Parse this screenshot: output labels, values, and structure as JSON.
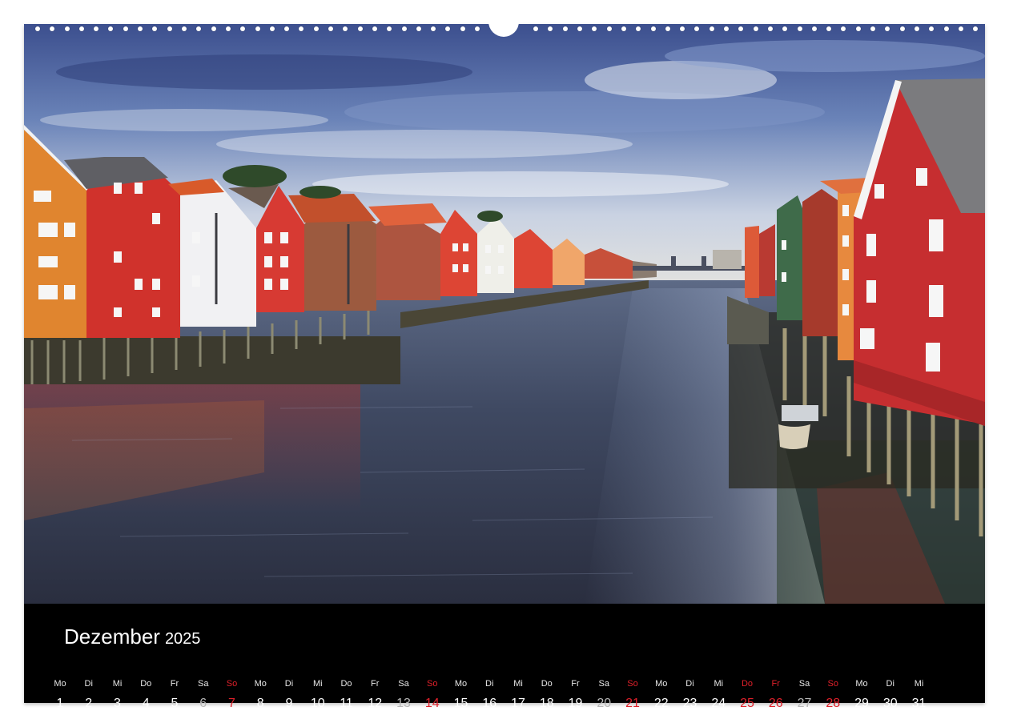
{
  "calendar": {
    "month": "Dezember",
    "year": "2025",
    "days": [
      {
        "dow": "Mo",
        "num": "1",
        "type": "normal"
      },
      {
        "dow": "Di",
        "num": "2",
        "type": "normal"
      },
      {
        "dow": "Mi",
        "num": "3",
        "type": "normal"
      },
      {
        "dow": "Do",
        "num": "4",
        "type": "normal"
      },
      {
        "dow": "Fr",
        "num": "5",
        "type": "normal"
      },
      {
        "dow": "Sa",
        "num": "6",
        "type": "saturday"
      },
      {
        "dow": "So",
        "num": "7",
        "type": "holiday"
      },
      {
        "dow": "Mo",
        "num": "8",
        "type": "normal"
      },
      {
        "dow": "Di",
        "num": "9",
        "type": "normal"
      },
      {
        "dow": "Mi",
        "num": "10",
        "type": "normal"
      },
      {
        "dow": "Do",
        "num": "11",
        "type": "normal"
      },
      {
        "dow": "Fr",
        "num": "12",
        "type": "normal"
      },
      {
        "dow": "Sa",
        "num": "13",
        "type": "saturday"
      },
      {
        "dow": "So",
        "num": "14",
        "type": "holiday"
      },
      {
        "dow": "Mo",
        "num": "15",
        "type": "normal"
      },
      {
        "dow": "Di",
        "num": "16",
        "type": "normal"
      },
      {
        "dow": "Mi",
        "num": "17",
        "type": "normal"
      },
      {
        "dow": "Do",
        "num": "18",
        "type": "normal"
      },
      {
        "dow": "Fr",
        "num": "19",
        "type": "normal"
      },
      {
        "dow": "Sa",
        "num": "20",
        "type": "saturday"
      },
      {
        "dow": "So",
        "num": "21",
        "type": "holiday"
      },
      {
        "dow": "Mo",
        "num": "22",
        "type": "normal"
      },
      {
        "dow": "Di",
        "num": "23",
        "type": "normal"
      },
      {
        "dow": "Mi",
        "num": "24",
        "type": "normal"
      },
      {
        "dow": "Do",
        "num": "25",
        "type": "holiday"
      },
      {
        "dow": "Fr",
        "num": "26",
        "type": "holiday"
      },
      {
        "dow": "Sa",
        "num": "27",
        "type": "saturday"
      },
      {
        "dow": "So",
        "num": "28",
        "type": "holiday"
      },
      {
        "dow": "Mo",
        "num": "29",
        "type": "normal"
      },
      {
        "dow": "Di",
        "num": "30",
        "type": "normal"
      },
      {
        "dow": "Mi",
        "num": "31",
        "type": "normal"
      }
    ]
  },
  "colors": {
    "calendar_background": "#000000",
    "text": "#ffffff",
    "saturday": "#b8b8b8",
    "sunday_holiday": "#e0202a"
  }
}
